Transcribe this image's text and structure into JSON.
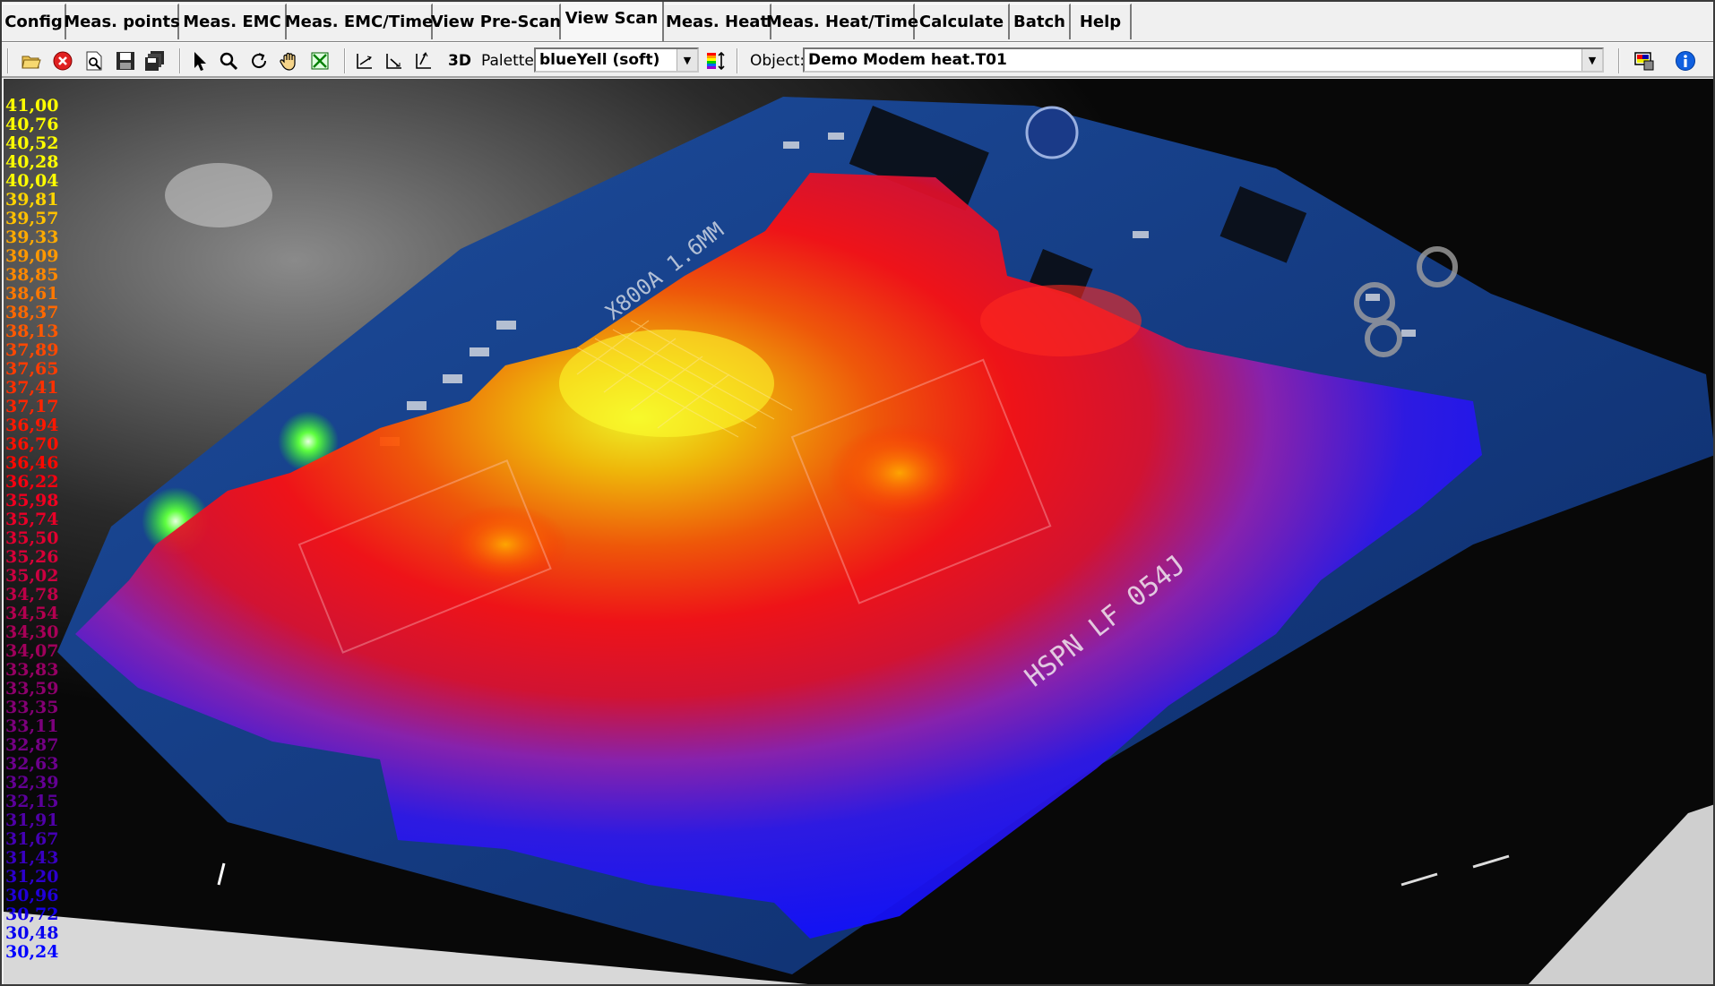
{
  "menu": {
    "tabs": [
      {
        "label": "Config",
        "active": false
      },
      {
        "label": "Meas. points",
        "active": false
      },
      {
        "label": "Meas. EMC",
        "active": false
      },
      {
        "label": "Meas. EMC/Time",
        "active": false
      },
      {
        "label": "View Pre-Scan",
        "active": false
      },
      {
        "label": "View Scan",
        "active": true
      },
      {
        "label": "Meas. Heat",
        "active": false
      },
      {
        "label": "Meas. Heat/Time",
        "active": false
      },
      {
        "label": "Calculate",
        "active": false
      },
      {
        "label": "Batch",
        "active": false
      },
      {
        "label": "Help",
        "active": false
      }
    ]
  },
  "toolbar": {
    "mode_3d_label": "3D",
    "palette_label": "Palette:",
    "palette_value": "blueYell (soft)",
    "object_label": "Object:",
    "object_value": "Demo Modem heat.T01"
  },
  "temperature_scale": {
    "values": [
      "41,00",
      "40,76",
      "40,52",
      "40,28",
      "40,04",
      "39,81",
      "39,57",
      "39,33",
      "39,09",
      "38,85",
      "38,61",
      "38,37",
      "38,13",
      "37,89",
      "37,65",
      "37,41",
      "37,17",
      "36,94",
      "36,70",
      "36,46",
      "36,22",
      "35,98",
      "35,74",
      "35,50",
      "35,26",
      "35,02",
      "34,78",
      "34,54",
      "34,30",
      "34,07",
      "33,83",
      "33,59",
      "33,35",
      "33,11",
      "32,87",
      "32,63",
      "32,39",
      "32,15",
      "31,91",
      "31,67",
      "31,43",
      "31,20",
      "30,96",
      "30,72",
      "30,48",
      "30,24"
    ],
    "colors": [
      "#ffff00",
      "#ffff00",
      "#ffff00",
      "#ffff00",
      "#ffff00",
      "#ffd400",
      "#ffc000",
      "#ffaa00",
      "#ff9800",
      "#ff8800",
      "#ff7800",
      "#ff6800",
      "#ff5800",
      "#ff4800",
      "#ff3c00",
      "#ff3000",
      "#ff2400",
      "#ff1800",
      "#ff1000",
      "#ff0800",
      "#f80010",
      "#f00020",
      "#e80028",
      "#e00030",
      "#d80038",
      "#cc0040",
      "#c00048",
      "#b40050",
      "#a80058",
      "#a0005c",
      "#960064",
      "#8c006c",
      "#840074",
      "#7c007c",
      "#740084",
      "#6c008c",
      "#640094",
      "#5c009c",
      "#5000a8",
      "#4400b4",
      "#3800c0",
      "#2c00cc",
      "#2000d8",
      "#1400e4",
      "#0800f0",
      "#0000ff"
    ]
  }
}
